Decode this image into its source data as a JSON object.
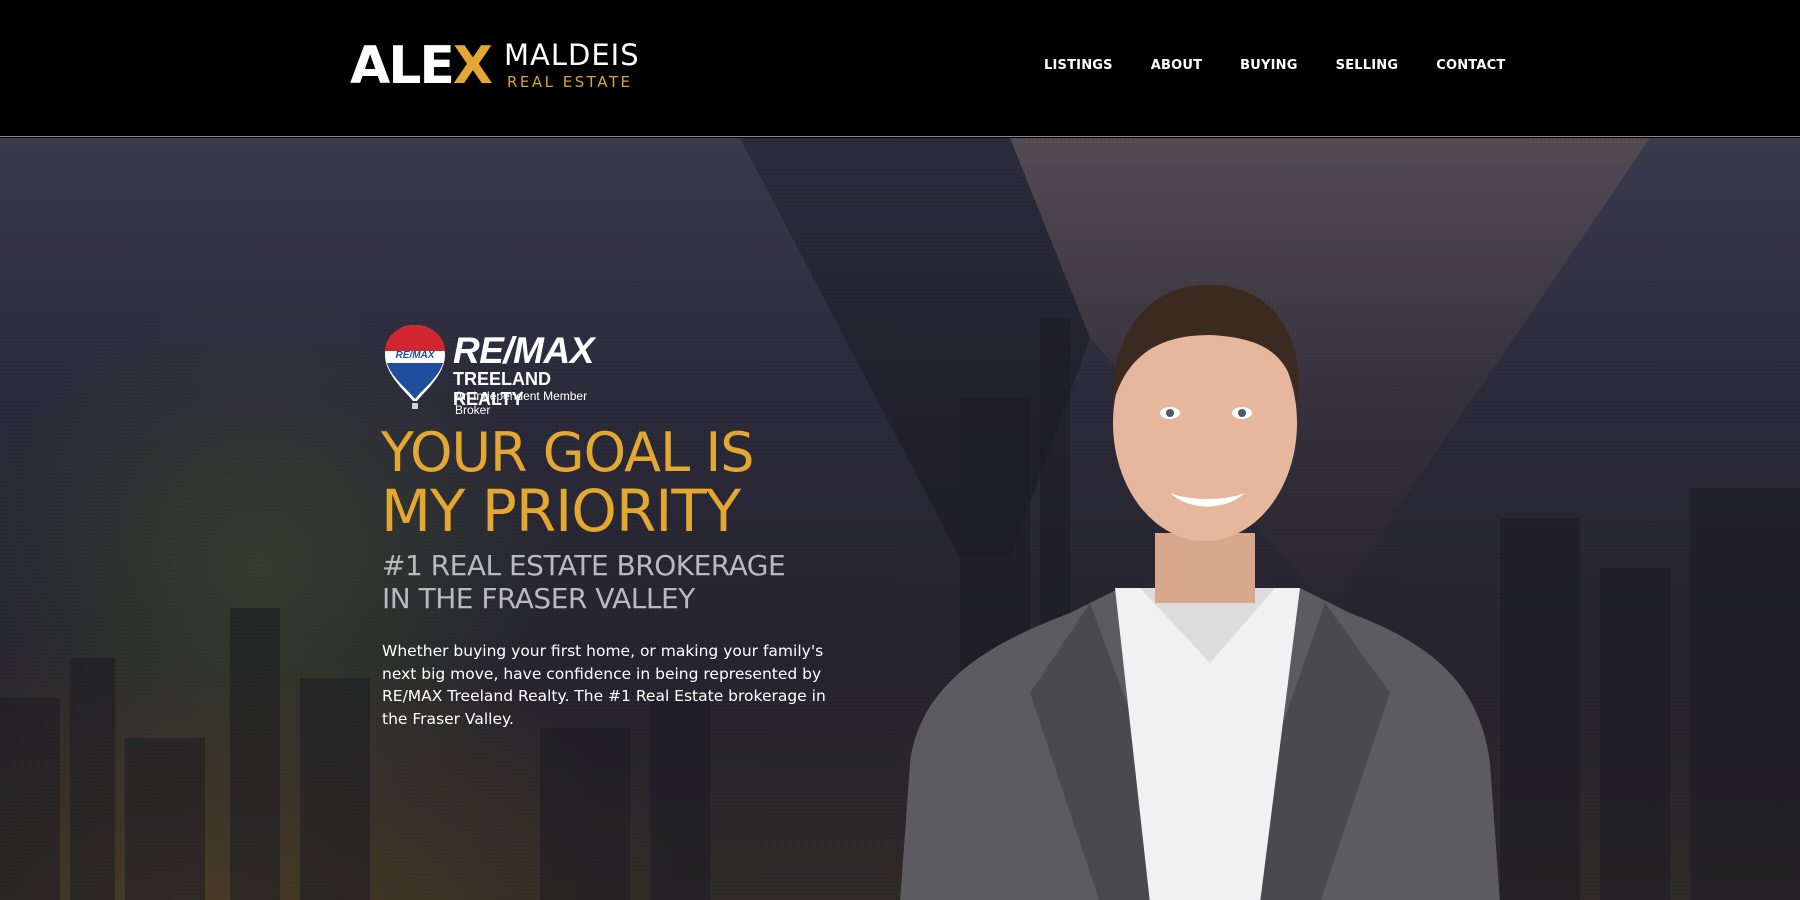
{
  "brand": {
    "first": "ALE",
    "x": "X",
    "last": "MALDEIS",
    "sub": "REAL ESTATE"
  },
  "nav": {
    "items": [
      "LISTINGS",
      "ABOUT",
      "BUYING",
      "SELLING",
      "CONTACT"
    ]
  },
  "remax": {
    "balloon_text": "RE/MAX",
    "wordmark": "RE/MAX",
    "office": "TREELAND REALTY",
    "tagline": "An Independent Member Broker"
  },
  "hero": {
    "headline_line1": "YOUR GOAL IS",
    "headline_line2": "MY PRIORITY",
    "subhead_line1": "#1 REAL ESTATE BROKERAGE",
    "subhead_line2": "IN THE FRASER VALLEY",
    "body": "Whether buying your first home, or making your family's next big move, have confidence in being represented by RE/MAX Treeland Realty. The #1 Real Estate brokerage in the Fraser Valley."
  },
  "colors": {
    "accent_gold": "#e3a832",
    "header_bg": "#000000",
    "remax_red": "#d0262f",
    "remax_blue": "#1f4f9c"
  }
}
